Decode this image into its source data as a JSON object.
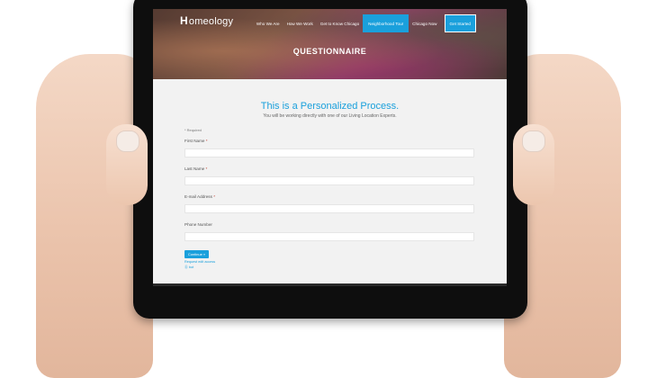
{
  "site": {
    "logo_text": "omeology",
    "logo_mark": "H"
  },
  "nav": {
    "items": [
      {
        "label": "Who We Are"
      },
      {
        "label": "How We Work"
      },
      {
        "label": "Get to Know Chicago"
      },
      {
        "label": "Neighborhood Tour"
      },
      {
        "label": "Chicago Now"
      }
    ],
    "cta_label": "Get Started",
    "active_index": 3
  },
  "hero": {
    "title": "QUESTIONNAIRE"
  },
  "content": {
    "headline": "This is a Personalized Process.",
    "subline": "You will be working directly with one of our Living Location Experts.",
    "required_note": "* Required",
    "fields": [
      {
        "label": "First Name",
        "required_mark": "*",
        "value": ""
      },
      {
        "label": "Last Name",
        "required_mark": "*",
        "value": ""
      },
      {
        "label": "E-mail Address",
        "required_mark": "*",
        "value": ""
      },
      {
        "label": "Phone Number",
        "required_mark": "",
        "value": ""
      }
    ],
    "continue_label": "Continue »",
    "edit_access_link": "Request edit access",
    "bot_link": "Ⓖ bot"
  },
  "colors": {
    "accent": "#1aa0dc",
    "page_bg": "#f2f2f2"
  }
}
